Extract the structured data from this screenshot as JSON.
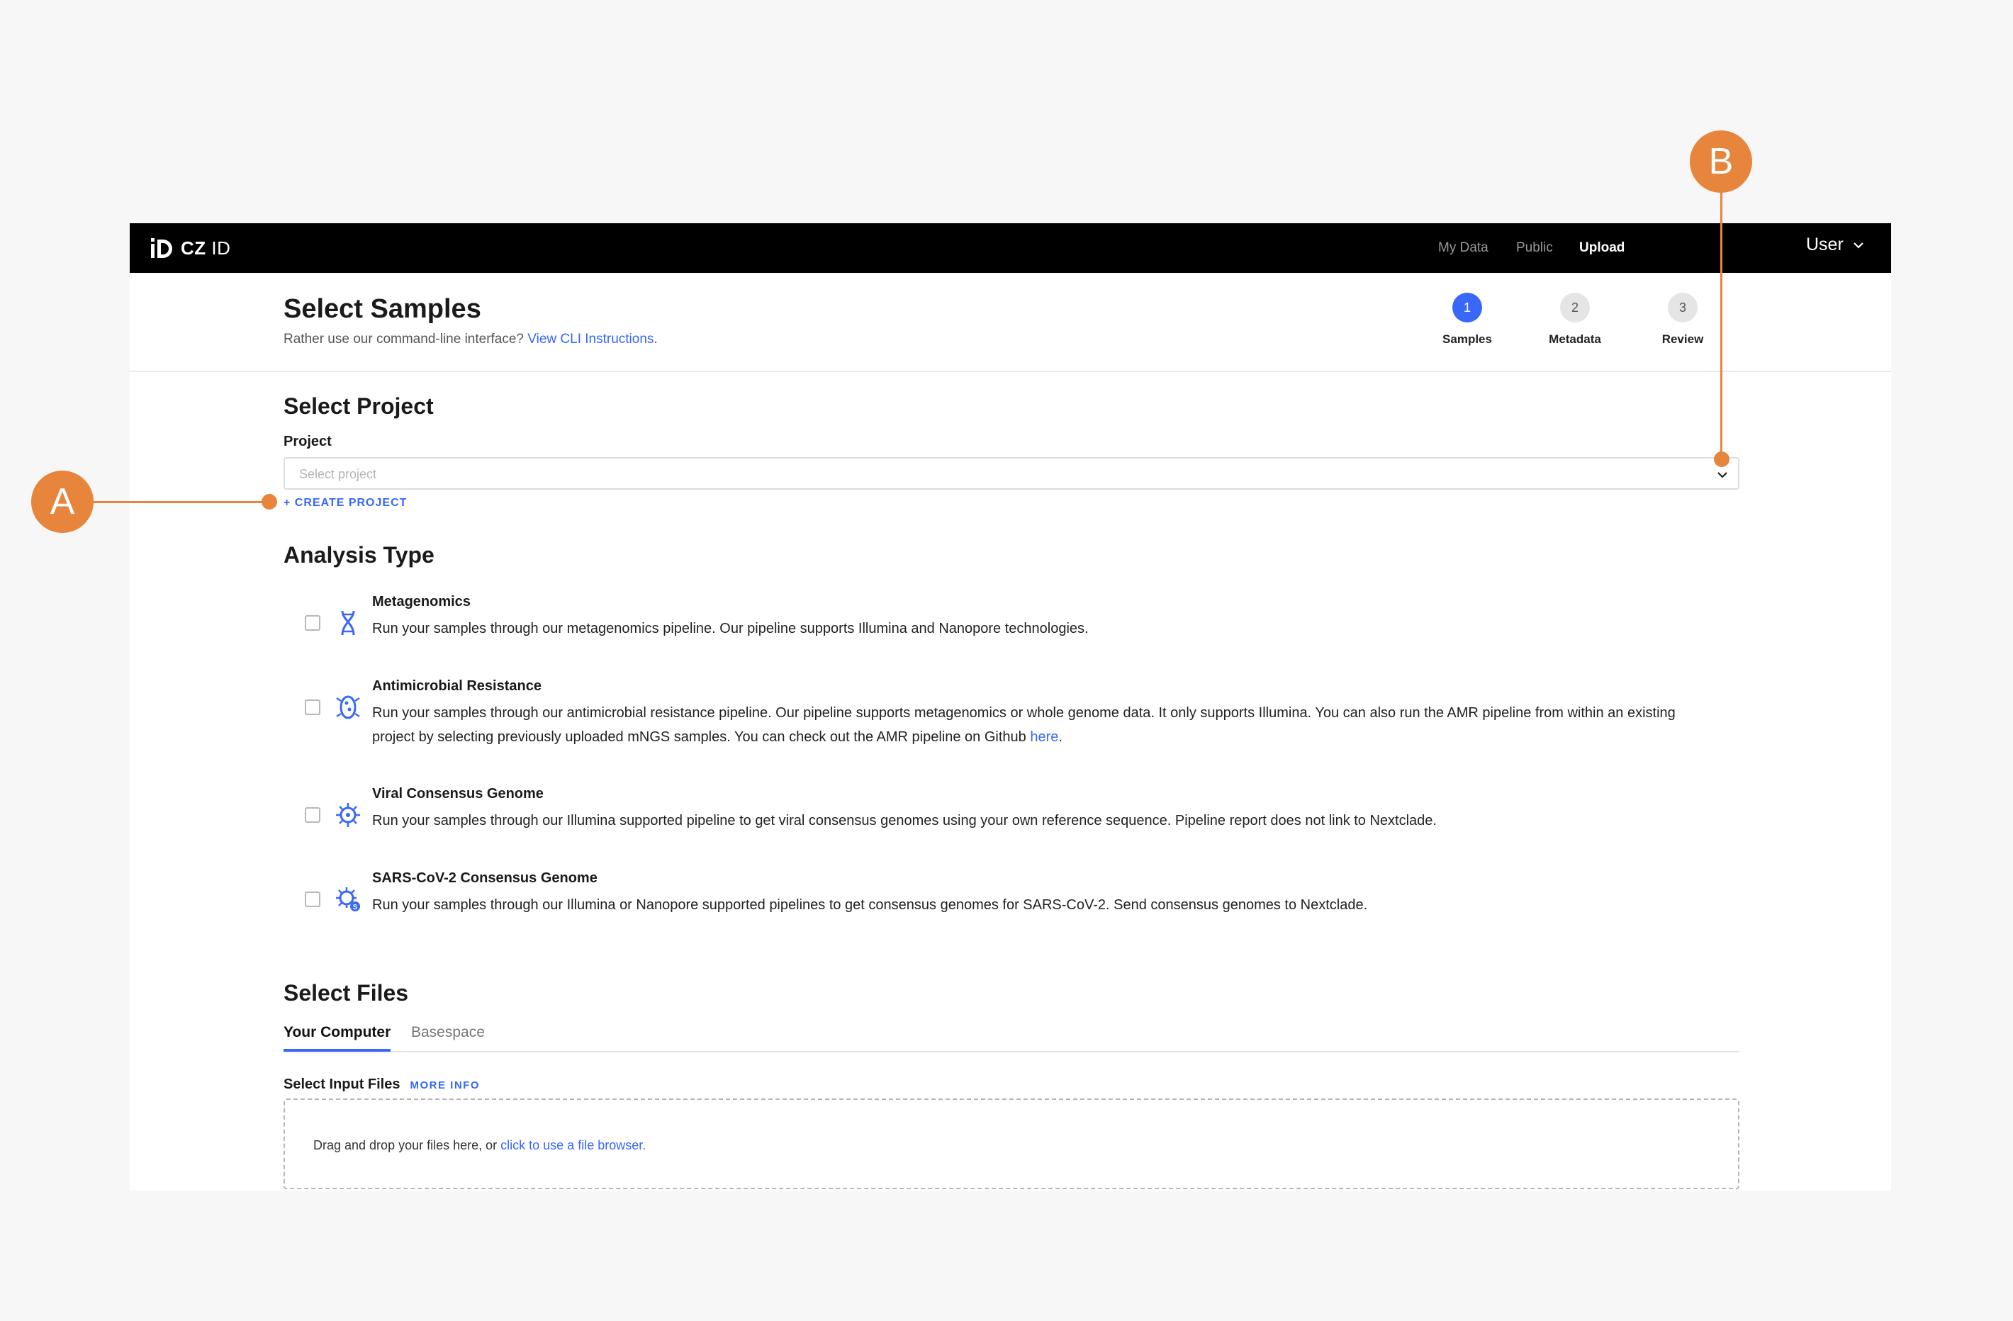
{
  "app": {
    "logo_text_bold": "CZ",
    "logo_text_light": "ID",
    "nav": [
      {
        "label": "My Data"
      },
      {
        "label": "Public"
      },
      {
        "label": "Upload"
      }
    ],
    "user_label": "User"
  },
  "header": {
    "title": "Select Samples",
    "subtitle_text": "Rather use our command-line interface?",
    "subtitle_link": "View CLI Instructions",
    "subtitle_end": ".",
    "steps": [
      {
        "number": "1",
        "label": "Samples",
        "active": true
      },
      {
        "number": "2",
        "label": "Metadata",
        "active": false
      },
      {
        "number": "3",
        "label": "Review",
        "active": false
      }
    ]
  },
  "project": {
    "section_title": "Select Project",
    "field_label": "Project",
    "placeholder": "Select project",
    "create_link": "+ CREATE PROJECT"
  },
  "analysis": {
    "section_title": "Analysis Type",
    "options": [
      {
        "title": "Metagenomics",
        "description": "Run your samples through our metagenomics pipeline. Our pipeline supports Illumina and Nanopore technologies.",
        "icon": "dna-icon"
      },
      {
        "title": "Antimicrobial Resistance",
        "description": "Run your samples through our antimicrobial resistance pipeline. Our pipeline supports metagenomics or whole genome data. It only supports Illumina. You can also run the AMR pipeline from within an existing project by selecting previously uploaded mNGS samples. You can check out the AMR pipeline on Github",
        "link": "here",
        "end": ".",
        "icon": "bacteria-icon"
      },
      {
        "title": "Viral Consensus Genome",
        "description": "Run your samples through our Illumina supported pipeline to get viral consensus genomes using your own reference sequence. Pipeline report does not link to Nextclade.",
        "icon": "virus-icon"
      },
      {
        "title": "SARS-CoV-2 Consensus Genome",
        "description": "Run your samples through our Illumina or Nanopore supported pipelines to get consensus genomes for SARS-CoV-2. Send consensus genomes to Nextclade.",
        "icon": "covid-virus-icon"
      }
    ]
  },
  "files": {
    "section_title": "Select Files",
    "tabs": [
      {
        "label": "Your Computer"
      },
      {
        "label": "Basespace"
      }
    ],
    "input_label": "Select Input Files",
    "more_info": "MORE INFO",
    "drop_text": "Drag and drop your files here, or",
    "drop_link": "click to use a file browser."
  },
  "callouts": {
    "a": "A",
    "b": "B"
  },
  "colors": {
    "accent": "#3867fa",
    "callout": "#e8853c",
    "topbar": "#000000"
  }
}
